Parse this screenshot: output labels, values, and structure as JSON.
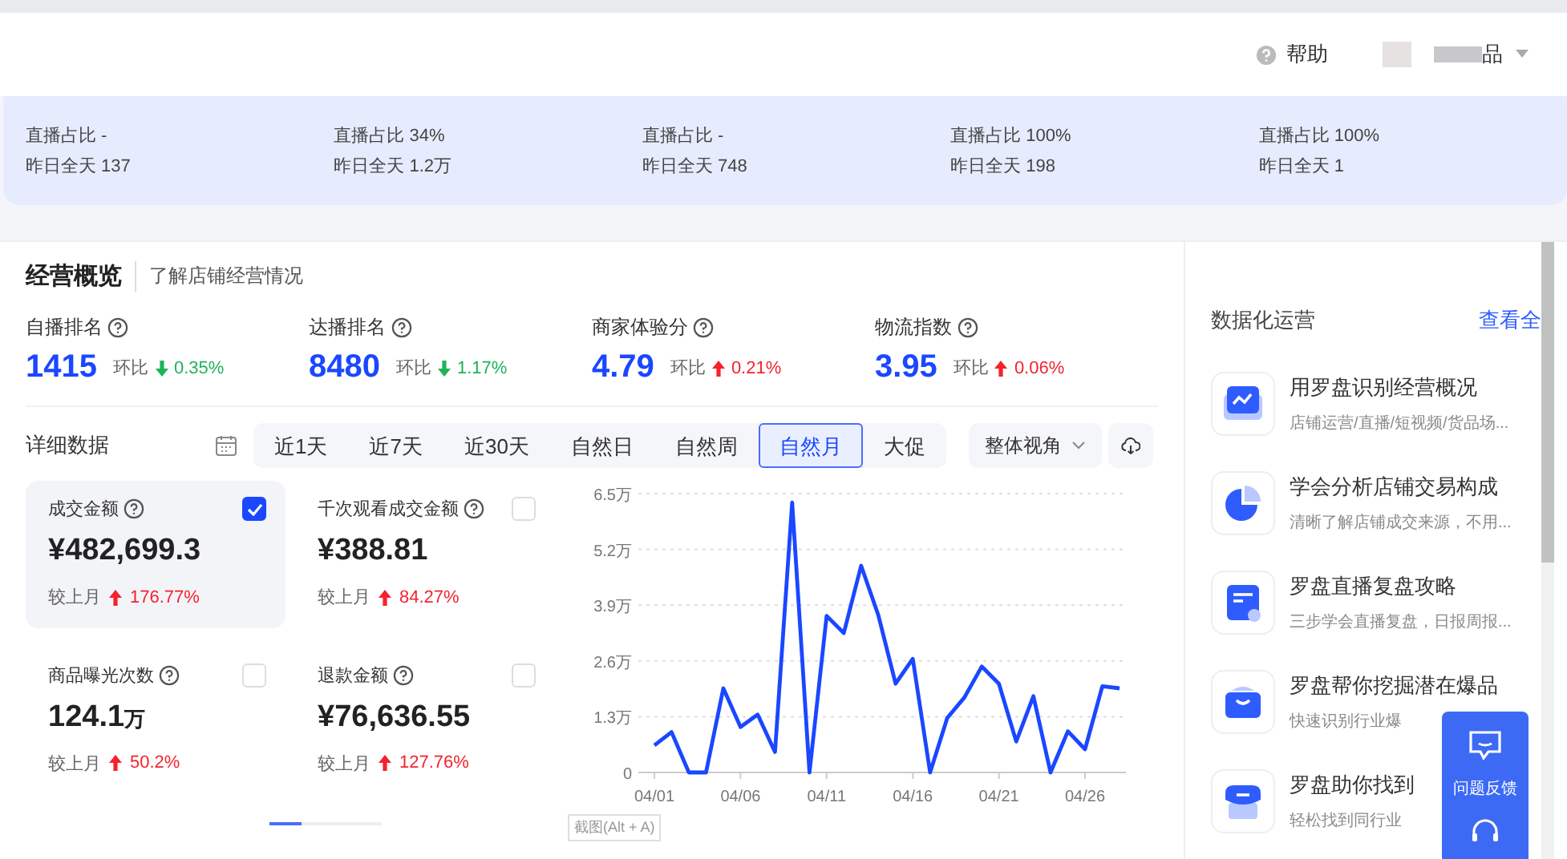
{
  "header": {
    "help": "帮助",
    "user_name": "品"
  },
  "banner": [
    {
      "ratio": "直播占比 -",
      "yesterday": "昨日全天 137"
    },
    {
      "ratio": "直播占比 34%",
      "yesterday": "昨日全天 1.2万"
    },
    {
      "ratio": "直播占比 -",
      "yesterday": "昨日全天 748"
    },
    {
      "ratio": "直播占比 100%",
      "yesterday": "昨日全天 198"
    },
    {
      "ratio": "直播占比 100%",
      "yesterday": "昨日全天 1"
    }
  ],
  "overview": {
    "title": "经营概览",
    "subtitle": "了解店铺经营情况",
    "metrics": [
      {
        "label": "自播排名",
        "value": "1415",
        "compare": "环比",
        "rising": false,
        "change": "0.35%"
      },
      {
        "label": "达播排名",
        "value": "8480",
        "compare": "环比",
        "rising": false,
        "change": "1.17%"
      },
      {
        "label": "商家体验分",
        "value": "4.79",
        "compare": "环比",
        "rising": true,
        "change": "0.21%"
      },
      {
        "label": "物流指数",
        "value": "3.95",
        "compare": "环比",
        "rising": true,
        "change": "0.06%"
      }
    ]
  },
  "detail": {
    "title": "详细数据",
    "ranges": [
      {
        "label": "近1天",
        "selected": false
      },
      {
        "label": "近7天",
        "selected": false
      },
      {
        "label": "近30天",
        "selected": false
      },
      {
        "label": "自然日",
        "selected": false
      },
      {
        "label": "自然周",
        "selected": false
      },
      {
        "label": "自然月",
        "selected": true
      },
      {
        "label": "大促",
        "selected": false
      }
    ],
    "view": "整体视角",
    "cards": [
      {
        "label": "成交金额",
        "value": "¥482,699.3",
        "compare": "较上月",
        "rising": true,
        "change": "176.77%",
        "checked": true
      },
      {
        "label": "千次观看成交金额",
        "value": "¥388.81",
        "compare": "较上月",
        "rising": true,
        "change": "84.27%",
        "checked": false
      },
      {
        "label": "商品曝光次数",
        "value": "124.1",
        "unit": "万",
        "compare": "较上月",
        "rising": true,
        "change": "50.2%",
        "checked": false
      },
      {
        "label": "退款金额",
        "value": "¥76,636.55",
        "compare": "较上月",
        "rising": true,
        "change": "127.76%",
        "checked": false
      }
    ],
    "chart_data": {
      "type": "line",
      "categories": [
        "04/01",
        null,
        null,
        null,
        null,
        "04/06",
        null,
        null,
        null,
        null,
        "04/11",
        null,
        null,
        null,
        null,
        "04/16",
        null,
        null,
        null,
        null,
        "04/21",
        null,
        null,
        null,
        null,
        "04/26",
        null,
        null
      ],
      "series": [
        {
          "color": "#1a47ff",
          "values": [
            0.63,
            0.94,
            0,
            0,
            1.96,
            1.06,
            1.35,
            0.48,
            6.29,
            0,
            3.65,
            3.25,
            4.82,
            3.67,
            2.07,
            2.65,
            0,
            1.27,
            1.75,
            2.47,
            2.07,
            0.72,
            1.78,
            0,
            0.96,
            0.54,
            2.01,
            1.96
          ]
        }
      ],
      "ylim": [
        0,
        6.5
      ],
      "grid": true,
      "yticks": [
        {
          "value": 0,
          "label": "0"
        },
        {
          "value": 1.3,
          "label": "1.3万"
        },
        {
          "value": 2.6,
          "label": "2.6万"
        },
        {
          "value": 3.9,
          "label": "3.9万"
        },
        {
          "value": 5.2,
          "label": "5.2万"
        },
        {
          "value": 6.5,
          "label": "6.5万"
        }
      ]
    },
    "screenshot_hint": "截图(Alt + A)"
  },
  "operations": {
    "title": "数据化运营",
    "link": "查看全",
    "items": [
      {
        "kind": "chart",
        "title": "用罗盘识别经营概况",
        "desc": "店铺运营/直播/短视频/货品场..."
      },
      {
        "kind": "pie",
        "title": "学会分析店铺交易构成",
        "desc": "清晰了解店铺成交来源，不用..."
      },
      {
        "kind": "doc",
        "title": "罗盘直播复盘攻略",
        "desc": "三步学会直播复盘，日报周报..."
      },
      {
        "kind": "basket",
        "title": "罗盘帮你挖掘潜在爆品",
        "desc": "快速识别行业爆"
      },
      {
        "kind": "shop",
        "title": "罗盘助你找到",
        "desc": "轻松找到同行业"
      }
    ]
  },
  "feedback": {
    "label": "问题反馈"
  }
}
